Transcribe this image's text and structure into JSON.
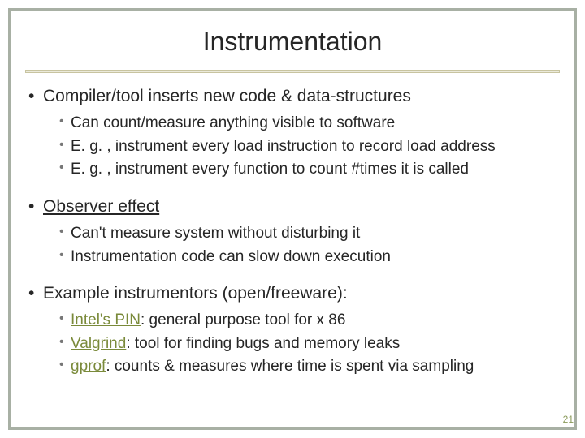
{
  "title": "Instrumentation",
  "sections": [
    {
      "heading": "Compiler/tool inserts new code & data-structures",
      "heading_underline": false,
      "items": [
        {
          "text": "Can count/measure anything visible to software",
          "link": null
        },
        {
          "text": "E. g. , instrument every load instruction to record load address",
          "link": null
        },
        {
          "text": "E. g. , instrument every function to count #times it is called",
          "link": null
        }
      ]
    },
    {
      "heading": "Observer effect",
      "heading_underline": true,
      "items": [
        {
          "text": "Can't measure system without disturbing it",
          "link": null
        },
        {
          "text": "Instrumentation code can slow down execution",
          "link": null
        }
      ]
    },
    {
      "heading": "Example instrumentors (open/freeware):",
      "heading_underline": false,
      "items": [
        {
          "link": "Intel's PIN",
          "text": ": general purpose tool for x 86"
        },
        {
          "link": "Valgrind",
          "text": ": tool for finding bugs and memory leaks"
        },
        {
          "link": "gprof",
          "text": ": counts & measures where time is spent via sampling"
        }
      ]
    }
  ],
  "page_number": "21"
}
